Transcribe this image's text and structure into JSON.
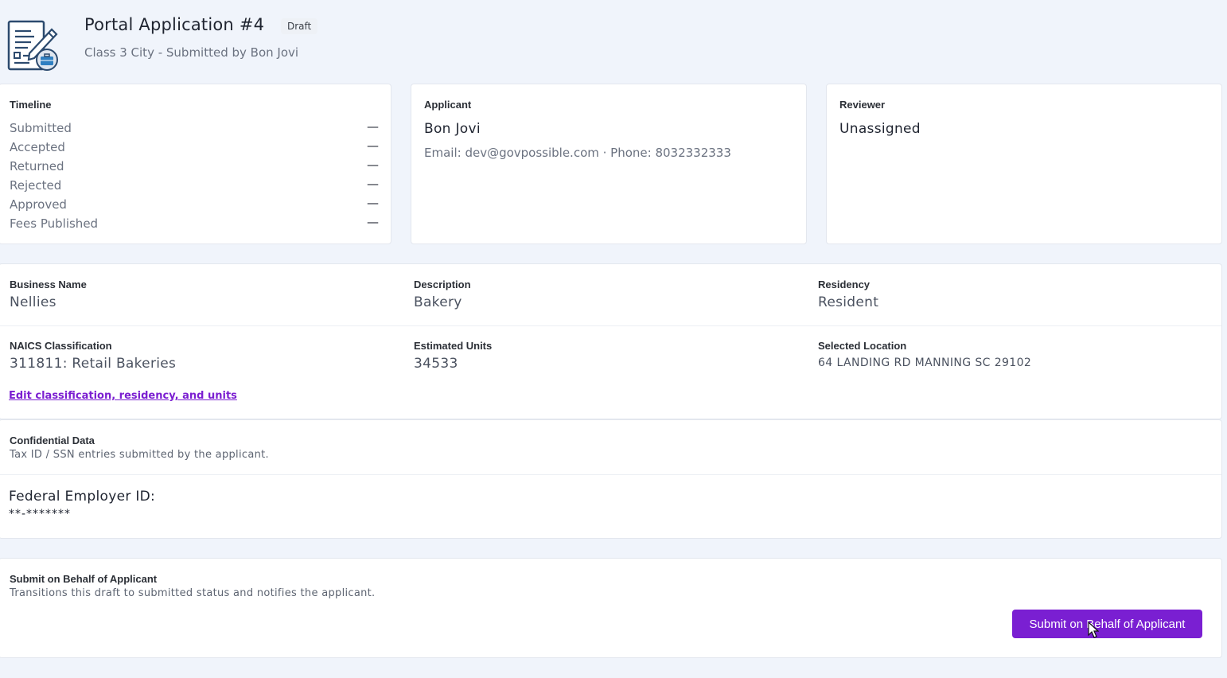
{
  "header": {
    "title": "Portal Application #4",
    "status_badge": "Draft",
    "subtitle": "Class 3 City - Submitted by Bon Jovi",
    "icon": "application-document-icon"
  },
  "timeline": {
    "label": "Timeline",
    "items": [
      {
        "label": "Submitted",
        "value": "—"
      },
      {
        "label": "Accepted",
        "value": "—"
      },
      {
        "label": "Returned",
        "value": "—"
      },
      {
        "label": "Rejected",
        "value": "—"
      },
      {
        "label": "Approved",
        "value": "—"
      },
      {
        "label": "Fees Published",
        "value": "—"
      }
    ]
  },
  "applicant": {
    "label": "Applicant",
    "name": "Bon Jovi",
    "contact": "Email: dev@govpossible.com · Phone: 8032332333"
  },
  "reviewer": {
    "label": "Reviewer",
    "name": "Unassigned"
  },
  "business": {
    "business_name_label": "Business Name",
    "business_name": "Nellies",
    "description_label": "Description",
    "description": "Bakery",
    "residency_label": "Residency",
    "residency": "Resident",
    "naics_label": "NAICS Classification",
    "naics": "311811: Retail Bakeries",
    "units_label": "Estimated Units",
    "units": "34533",
    "location_label": "Selected Location",
    "location": "64 LANDING RD MANNING SC 29102",
    "edit_link": "Edit classification, residency, and units"
  },
  "confidential": {
    "label": "Confidential Data",
    "description": "Tax ID / SSN entries submitted by the applicant.",
    "fein_label": "Federal Employer ID:",
    "fein_value": "**-*******"
  },
  "submit": {
    "label": "Submit on Behalf of Applicant",
    "description": "Transitions this draft to submitted status and notifies the applicant.",
    "button_label": "Submit on Behalf of Applicant"
  },
  "colors": {
    "accent": "#7a1fd2",
    "background": "#f0f4fb",
    "card": "#ffffff"
  }
}
